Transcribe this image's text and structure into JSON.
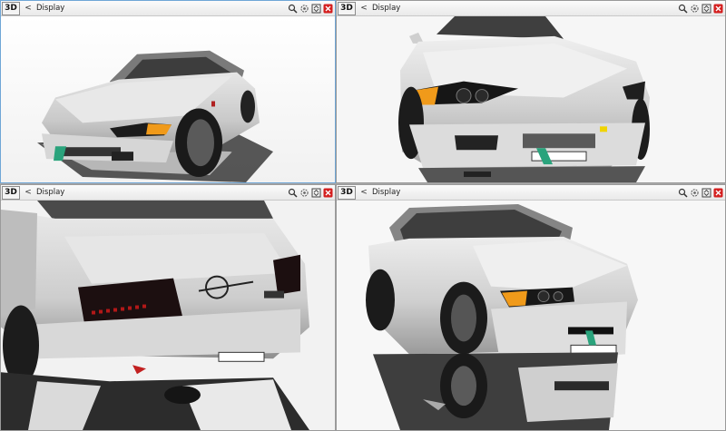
{
  "viewports": [
    {
      "mode": "3D",
      "back": "<",
      "title": "Display",
      "active": true,
      "tools": [
        "zoom-icon",
        "orbit-icon",
        "maximize-icon",
        "close-icon"
      ]
    },
    {
      "mode": "3D",
      "back": "<",
      "title": "Display",
      "active": false,
      "tools": [
        "zoom-icon",
        "orbit-icon",
        "maximize-icon",
        "close-icon"
      ]
    },
    {
      "mode": "3D",
      "back": "<",
      "title": "Display",
      "active": false,
      "tools": [
        "zoom-icon",
        "orbit-icon",
        "maximize-icon",
        "close-icon"
      ]
    },
    {
      "mode": "3D",
      "back": "<",
      "title": "Display",
      "active": false,
      "tools": [
        "zoom-icon",
        "orbit-icon",
        "maximize-icon",
        "close-icon"
      ]
    }
  ],
  "colors": {
    "active_border": "#6fa6d6",
    "car_body": "#d9d9d9",
    "headlight_amber": "#f09a1a",
    "close_red": "#d42020",
    "tow_strap": "#2aa37c"
  }
}
